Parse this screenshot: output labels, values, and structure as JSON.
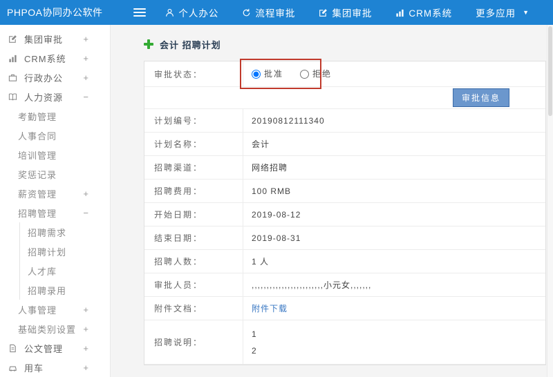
{
  "colors": {
    "topbar-blue": "#1e83d3",
    "accent-green": "#33aa33",
    "button-blue": "#6b97cd",
    "button-border": "#3c6ca8",
    "link-blue": "#3a78c3",
    "annotation-red": "#c0392b"
  },
  "topbar": {
    "brand": "PHPOA协同办公软件",
    "menu": [
      {
        "label": "个人办公",
        "icon": "person-icon",
        "caret": null
      },
      {
        "label": "流程审批",
        "icon": "process-icon",
        "caret": null
      },
      {
        "label": "集团审批",
        "icon": "approval-edit-icon",
        "caret": null
      },
      {
        "label": "CRM系统",
        "icon": "bar-chart-icon",
        "caret": null
      },
      {
        "label": "更多应用",
        "icon": null,
        "caret": "▼"
      }
    ]
  },
  "sidebar": {
    "items": [
      {
        "label": "集团审批",
        "icon": "approval-edit-icon",
        "toggle": "+",
        "level": 1
      },
      {
        "label": "CRM系统",
        "icon": "bar-chart-icon",
        "toggle": "+",
        "level": 1
      },
      {
        "label": "行政办公",
        "icon": "briefcase-icon",
        "toggle": "+",
        "level": 1
      },
      {
        "label": "人力资源",
        "icon": "book-icon",
        "toggle": "−",
        "level": 1
      },
      {
        "label": "考勤管理",
        "icon": null,
        "toggle": "",
        "level": 2
      },
      {
        "label": "人事合同",
        "icon": null,
        "toggle": "",
        "level": 2
      },
      {
        "label": "培训管理",
        "icon": null,
        "toggle": "",
        "level": 2
      },
      {
        "label": "奖惩记录",
        "icon": null,
        "toggle": "",
        "level": 2
      },
      {
        "label": "薪资管理",
        "icon": null,
        "toggle": "+",
        "level": 2
      },
      {
        "label": "招聘管理",
        "icon": null,
        "toggle": "−",
        "level": 2
      },
      {
        "label": "招聘需求",
        "icon": null,
        "toggle": "",
        "level": 3
      },
      {
        "label": "招聘计划",
        "icon": null,
        "toggle": "",
        "level": 3
      },
      {
        "label": "人才库",
        "icon": null,
        "toggle": "",
        "level": 3
      },
      {
        "label": "招聘录用",
        "icon": null,
        "toggle": "",
        "level": 3
      },
      {
        "label": "人事管理",
        "icon": null,
        "toggle": "+",
        "level": 2
      },
      {
        "label": "基础类别设置",
        "icon": null,
        "toggle": "+",
        "level": 2
      },
      {
        "label": "公文管理",
        "icon": "document-icon",
        "toggle": "+",
        "level": 1
      },
      {
        "label": "用车",
        "icon": "car-icon",
        "toggle": "+",
        "level": 1
      }
    ]
  },
  "main": {
    "page_title": "会计 招聘计划",
    "status": {
      "label": "审批状态：",
      "options": [
        {
          "label": "批准",
          "checked": true
        },
        {
          "label": "拒绝",
          "checked": false
        }
      ]
    },
    "approve_button_label": "审批信息",
    "fields": [
      {
        "label": "计划编号：",
        "value": "20190812111340",
        "type": "text",
        "tall": false
      },
      {
        "label": "计划名称：",
        "value": "会计",
        "type": "text",
        "tall": false
      },
      {
        "label": "招聘渠道：",
        "value": "网络招聘",
        "type": "text",
        "tall": false
      },
      {
        "label": "招聘费用：",
        "value": "100 RMB",
        "type": "text",
        "tall": false
      },
      {
        "label": "开始日期：",
        "value": "2019-08-12",
        "type": "text",
        "tall": false
      },
      {
        "label": "结束日期：",
        "value": "2019-08-31",
        "type": "text",
        "tall": false
      },
      {
        "label": "招聘人数：",
        "value": "1 人",
        "type": "text",
        "tall": false
      },
      {
        "label": "审批人员：",
        "value": ",,,,,,,,,,,,,,,,,,,,,,,,小元女,,,,,,,",
        "type": "text",
        "tall": false
      },
      {
        "label": "附件文档：",
        "value": "附件下载",
        "type": "link",
        "tall": false
      },
      {
        "label": "招聘说明：",
        "value": "1\n2",
        "type": "text",
        "tall": true
      }
    ]
  }
}
